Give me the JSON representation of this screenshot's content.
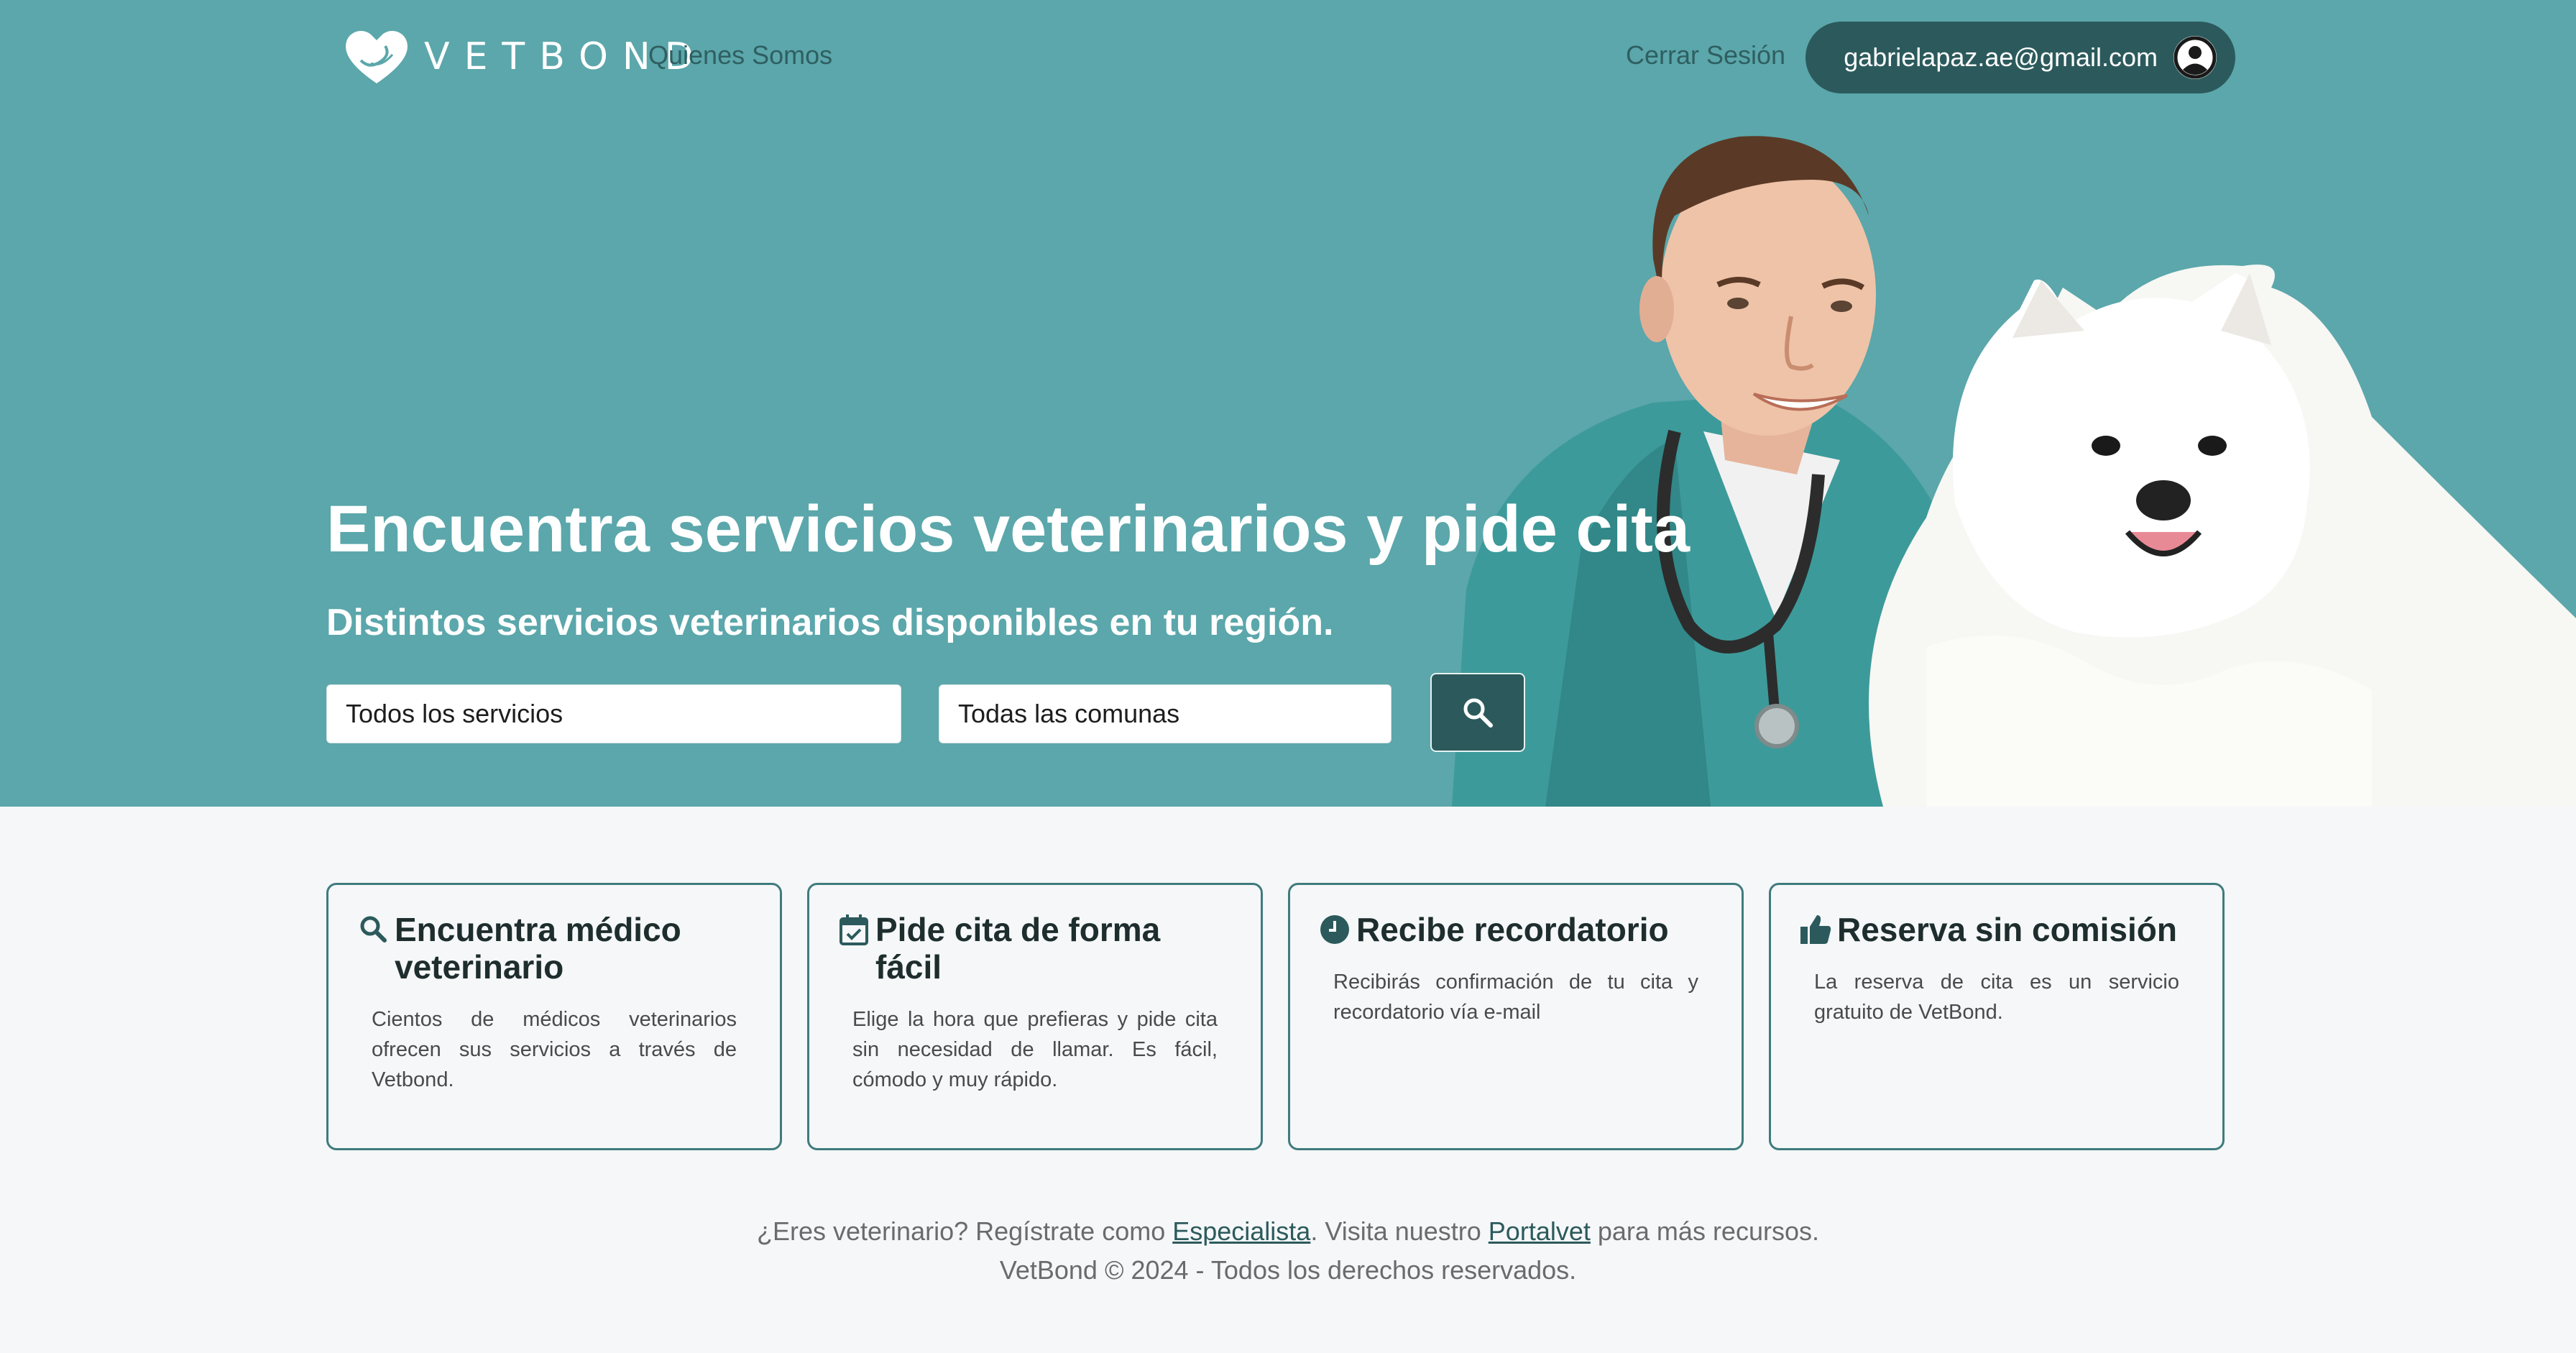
{
  "brand": {
    "name": "VETBOND"
  },
  "nav": {
    "about": "Quienes Somos",
    "logout": "Cerrar Sesión",
    "user_email": "gabrielapaz.ae@gmail.com"
  },
  "hero": {
    "title": "Encuentra servicios veterinarios y pide cita",
    "subtitle": "Distintos servicios veterinarios disponibles en tu región.",
    "service_select": "Todos los servicios",
    "comuna_select": "Todas las comunas"
  },
  "features": [
    {
      "icon": "search-icon",
      "title": "Encuentra médico veterinario",
      "text": "Cientos de médicos veterinarios ofrecen sus servicios a través de Vetbond."
    },
    {
      "icon": "calendar-check-icon",
      "title": "Pide cita de forma fácil",
      "text": "Elige la hora que prefieras y pide cita sin necesidad de llamar. Es fácil, cómodo y muy rápido."
    },
    {
      "icon": "clock-icon",
      "title": "Recibe recordatorio",
      "text": "Recibirás confirmación de tu cita y recordatorio vía e-mail"
    },
    {
      "icon": "thumbs-up-icon",
      "title": "Reserva sin comisión",
      "text": "La reserva de cita es un servicio gratuito de VetBond."
    }
  ],
  "footer": {
    "line1_a": "¿Eres veterinario? Regístrate como ",
    "specialist_link": "Especialista",
    "line1_b": ". Visita nuestro ",
    "portal_link": "Portalvet",
    "line1_c": " para más recursos.",
    "copyright": "VetBond © 2024 - Todos los derechos reservados."
  },
  "colors": {
    "hero_bg": "#5ba7ab",
    "accent_dark": "#2c5a5c",
    "card_border": "#3f7b7d",
    "page_bg": "#f5f7f8"
  }
}
